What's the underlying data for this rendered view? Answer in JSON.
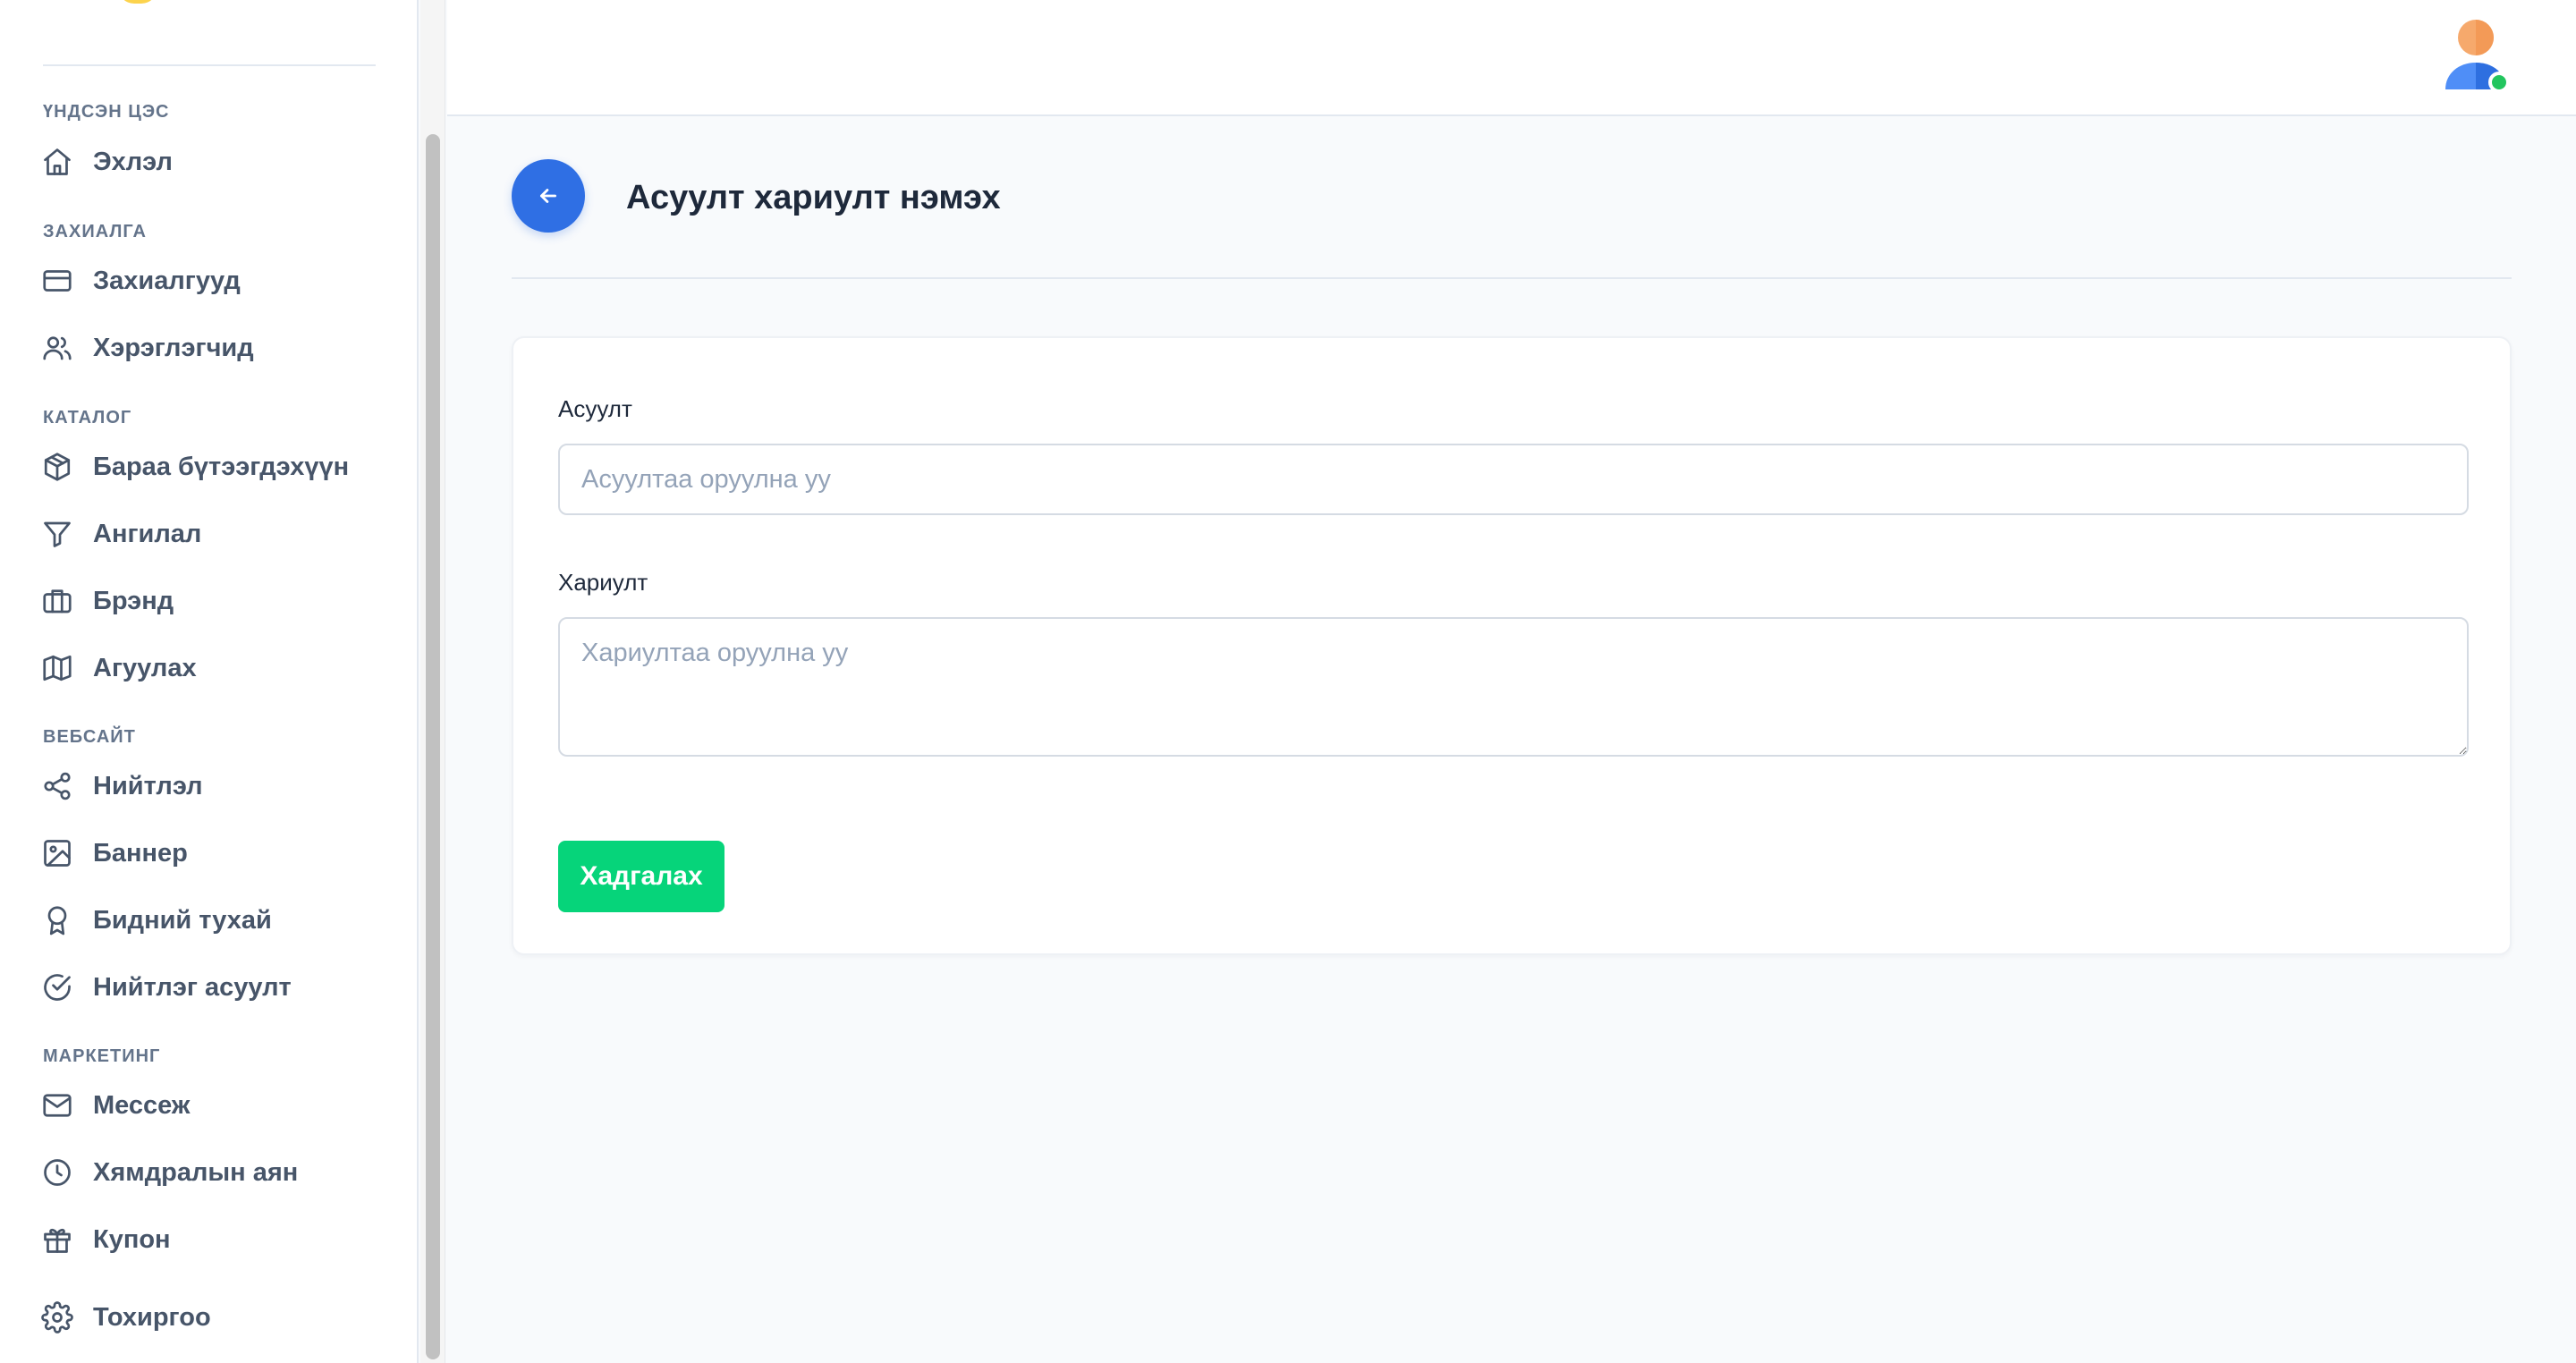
{
  "sidebar": {
    "sections": {
      "main": "ҮНДСЭН ЦЭС",
      "orders": "ЗАХИАЛГА",
      "catalog": "КАТАЛОГ",
      "website": "ВЕБСАЙТ",
      "marketing": "МАРКЕТИНГ"
    },
    "items": {
      "home": "Эхлэл",
      "orders": "Захиалгууд",
      "users": "Хэрэглэгчид",
      "products": "Бараа бүтээгдэхүүн",
      "categories": "Ангилал",
      "brands": "Брэнд",
      "warehouse": "Агуулах",
      "posts": "Нийтлэл",
      "banner": "Баннер",
      "about": "Бидний тухай",
      "faq": "Нийтлэг асуулт",
      "messages": "Мессеж",
      "discounts": "Хямдралын аян",
      "coupons": "Купон",
      "settings": "Тохиргоо"
    }
  },
  "header": {
    "title": "Асуулт хариулт нэмэх"
  },
  "form": {
    "question_label": "Асуулт",
    "question_placeholder": "Асуултаа оруулна уу",
    "question_value": "",
    "answer_label": "Хариулт",
    "answer_placeholder": "Хариултаа оруулна уу",
    "answer_value": "",
    "save_label": "Хадгалах"
  },
  "colors": {
    "primary": "#2f6fe4",
    "success": "#06d47a",
    "online": "#22c55e"
  }
}
